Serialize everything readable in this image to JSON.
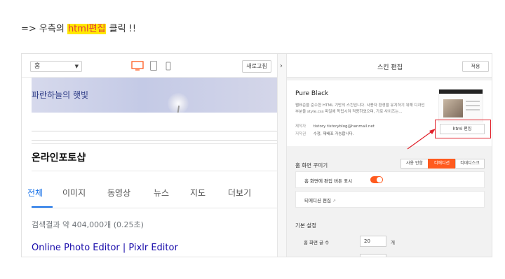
{
  "instruction": {
    "prefix": "=> 우측의 ",
    "highlight": "html편집",
    "suffix": " 클릭 !!"
  },
  "preview": {
    "home_select": "홈",
    "refresh_label": "새로고침",
    "blog_title": "파란하늘의 햇빛",
    "site_name": "온라인포토샵",
    "tabs": [
      {
        "label": "전체",
        "active": true
      },
      {
        "label": "이미지",
        "active": false
      },
      {
        "label": "동영상",
        "active": false
      },
      {
        "label": "뉴스",
        "active": false
      },
      {
        "label": "지도",
        "active": false
      },
      {
        "label": "더보기",
        "active": false
      }
    ],
    "result_stats": "검색결과 약 404,000개 (0.25초)",
    "result_title": "Online Photo Editor | Pixlr Editor"
  },
  "panel": {
    "title": "스킨 편집",
    "save_label": "적용",
    "skin": {
      "name": "Pure Black",
      "description": "웹표준을 준수한 HTML 기반의 스킨입니다. 사용자 환경을 유지하기 위해 디자인 부분을 style.css 파일에 독립시켜 적용하였으며, 가로 사이즈는...",
      "author_key": "제작자",
      "author_value": "tistory tistoryblog@hanmail.net",
      "license_key": "저작권",
      "license_value": "수정, 재배포 가능합니다.",
      "html_edit_label": "html 편집"
    },
    "home_section": {
      "label": "홈 화면 꾸미기",
      "segments": [
        "사용 안함",
        "티에디션",
        "티데디스크"
      ],
      "active_segment": "티에디션",
      "edit_button_row": "홈 화면에 편집 버튼 표시",
      "toggle_on": true,
      "tiara_edit_row": "티에디션 편집"
    },
    "basic_section": {
      "label": "기본 설정",
      "count_label": "홈 화면 글 수",
      "count_value": "20",
      "count_unit": "개"
    }
  },
  "colors": {
    "accent_orange": "#ff5a1e",
    "highlight_yellow": "#ffe800",
    "highlight_text": "#e0383e",
    "annotation_red": "#e0202a",
    "link_blue": "#1a0dab",
    "tab_blue": "#1a73e8"
  },
  "icons": {
    "desktop": "desktop-icon",
    "tablet": "tablet-icon",
    "mobile": "mobile-icon",
    "collapse": "chevron-right-icon",
    "external": "external-link-icon"
  }
}
